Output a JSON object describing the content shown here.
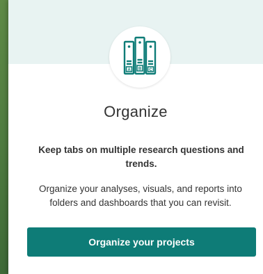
{
  "card": {
    "icon": "binders-abc-icon",
    "binders": [
      "A",
      "B",
      "C"
    ],
    "accent_color": "#0e7c77",
    "header_color": "#e8f3f2",
    "title": "Organize",
    "subtitle": "Keep tabs on multiple research questions and trends.",
    "description": "Organize your analyses, visuals, and reports into folders and dashboards that you can revisit.",
    "cta_label": "Organize your projects"
  }
}
